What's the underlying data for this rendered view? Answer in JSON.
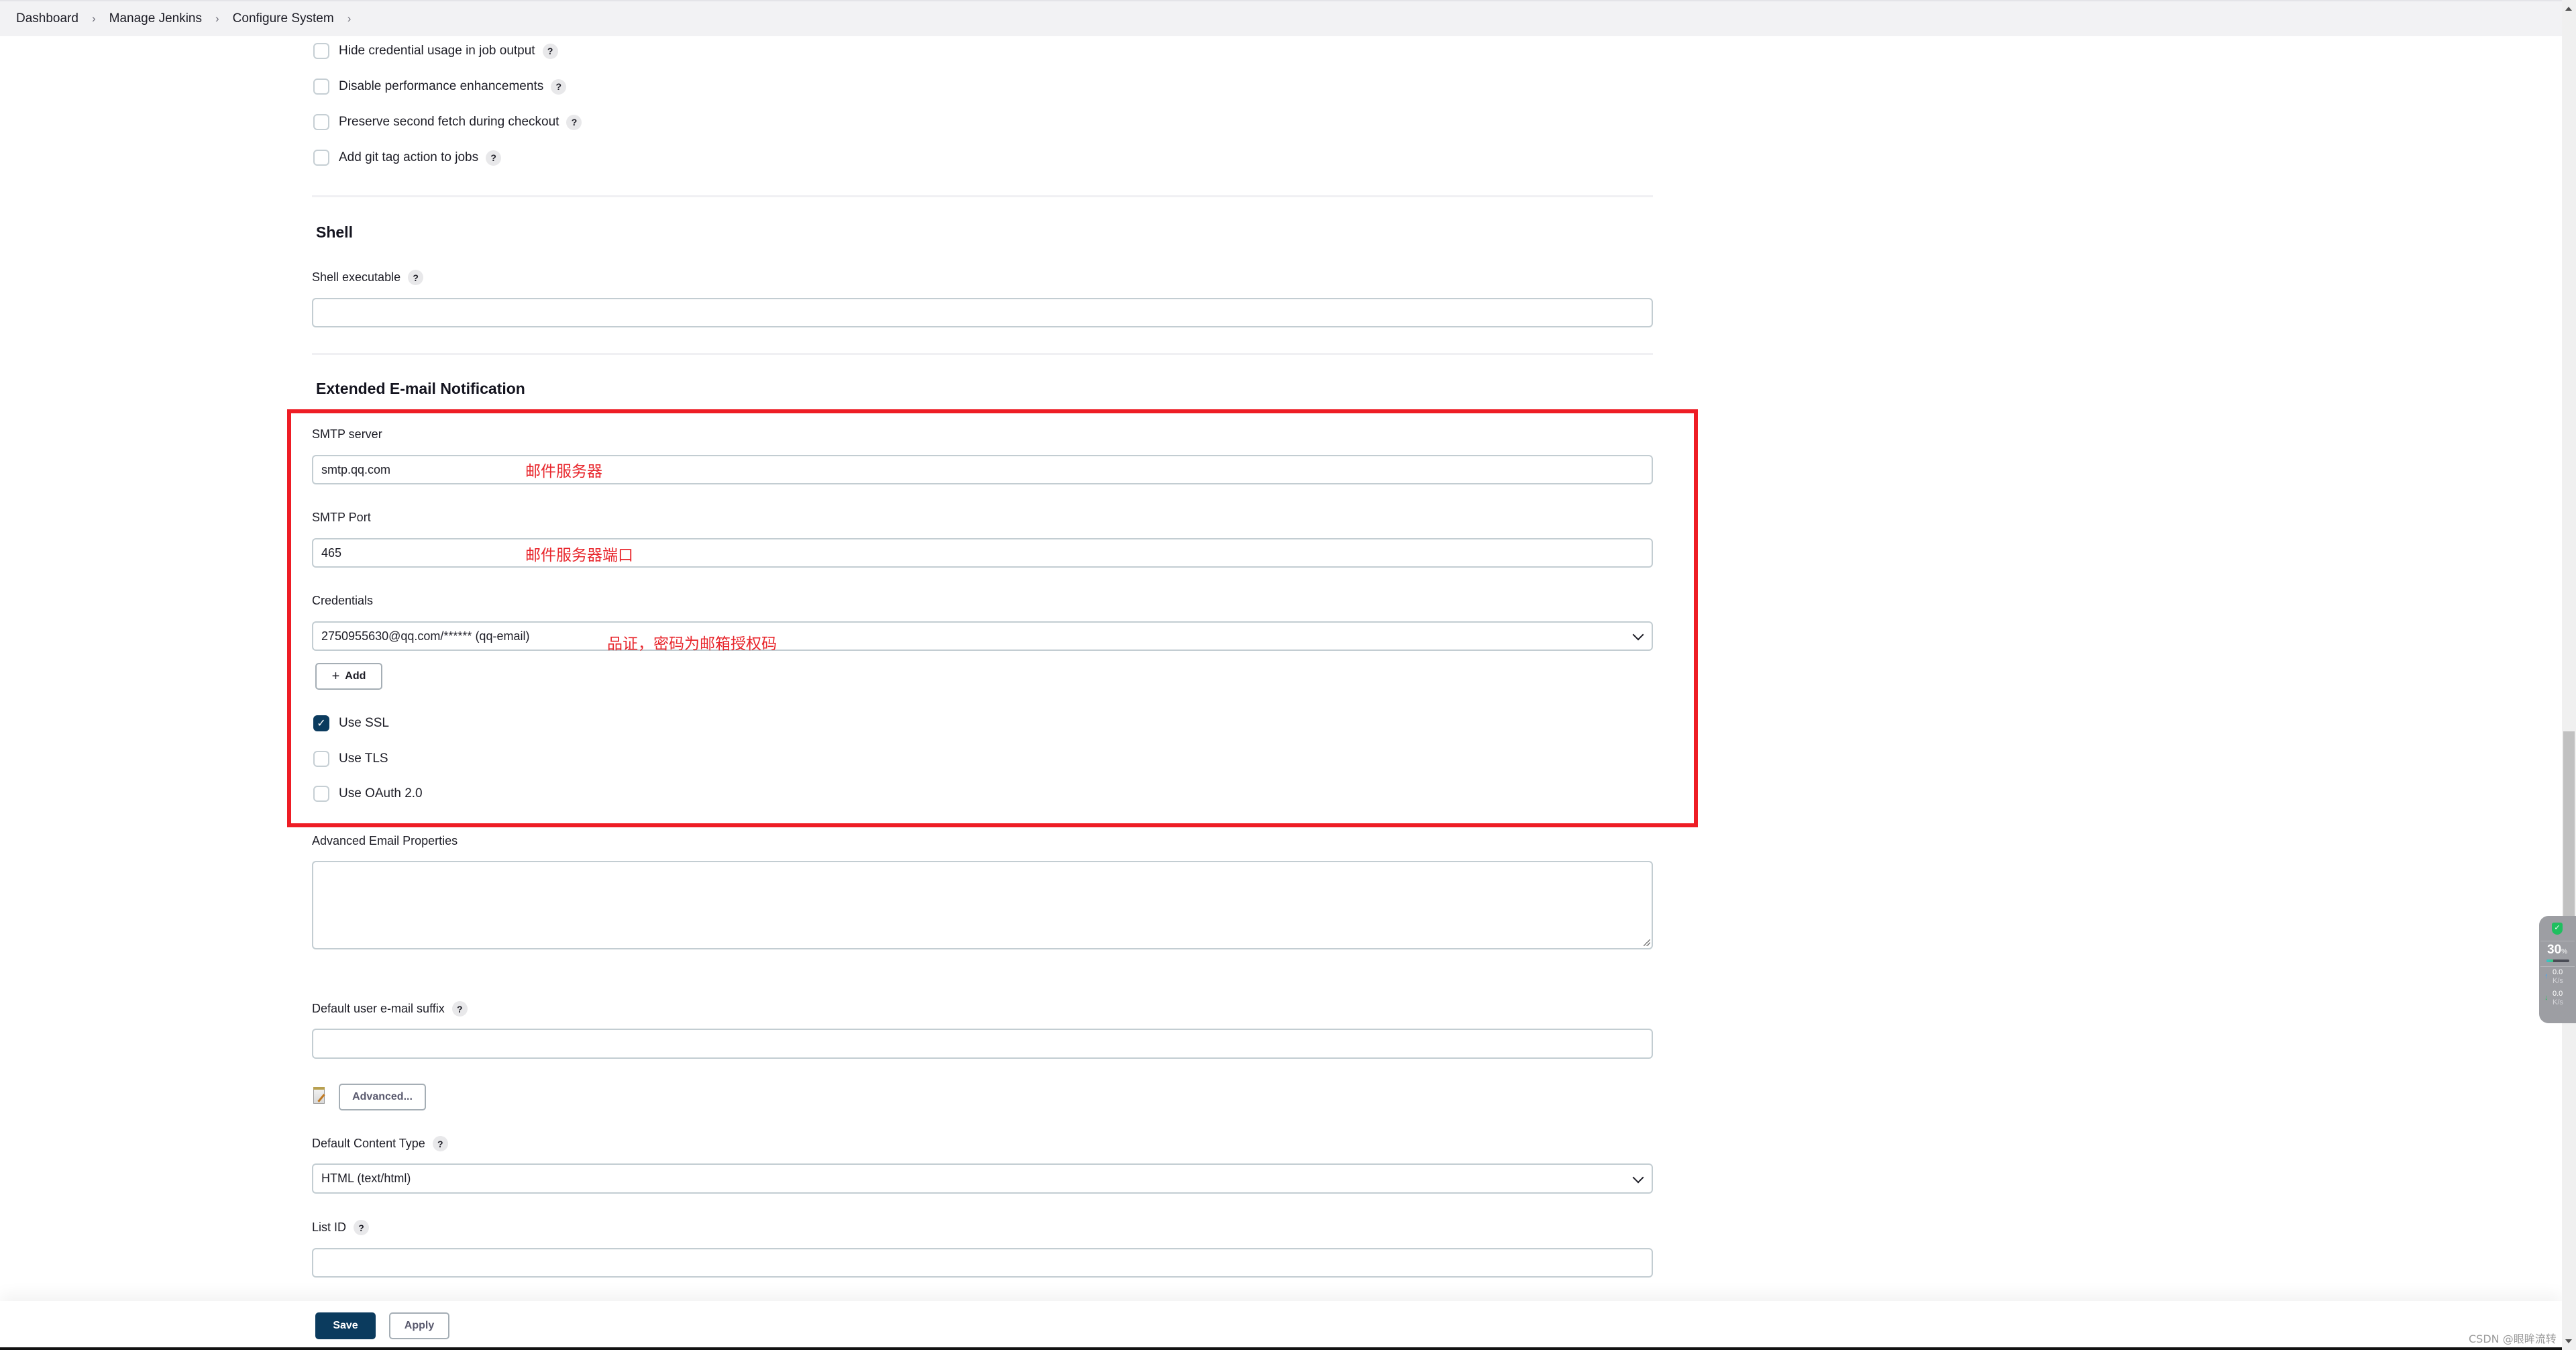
{
  "breadcrumb": [
    "Dashboard",
    "Manage Jenkins",
    "Configure System"
  ],
  "git_options": [
    {
      "label": "Hide credential usage in job output",
      "checked": false
    },
    {
      "label": "Disable performance enhancements",
      "checked": false
    },
    {
      "label": "Preserve second fetch during checkout",
      "checked": false
    },
    {
      "label": "Add git tag action to jobs",
      "checked": false
    }
  ],
  "help_glyph": "?",
  "shell": {
    "title": "Shell",
    "executable_label": "Shell executable",
    "executable_value": ""
  },
  "email_ext": {
    "title": "Extended E-mail Notification",
    "smtp_server_label": "SMTP server",
    "smtp_server_value": "smtp.qq.com",
    "smtp_server_annotation": "邮件服务器",
    "smtp_port_label": "SMTP Port",
    "smtp_port_value": "465",
    "smtp_port_annotation": "邮件服务器端口",
    "credentials_label": "Credentials",
    "credentials_value": "2750955630@qq.com/****** (qq-email)",
    "credentials_annotation": "品证，密码为邮箱授权码",
    "add_button": "Add",
    "add_icon": "+",
    "use_ssl": {
      "label": "Use SSL",
      "checked": true
    },
    "use_tls": {
      "label": "Use TLS",
      "checked": false
    },
    "use_oauth": {
      "label": "Use OAuth 2.0",
      "checked": false
    },
    "advanced_props_label": "Advanced Email Properties",
    "advanced_props_value": "",
    "default_suffix_label": "Default user e-mail suffix",
    "default_suffix_value": "",
    "advanced_button": "Advanced...",
    "content_type_label": "Default Content Type",
    "content_type_value": "HTML (text/html)",
    "list_id_label": "List ID",
    "list_id_value": ""
  },
  "footer": {
    "save": "Save",
    "apply": "Apply"
  },
  "widget": {
    "percent": "30",
    "percent_unit": "%",
    "upload": "0.0",
    "download": "0.0",
    "rate_unit": "K/s",
    "usage_fraction": 0.3
  },
  "watermark": "CSDN @眼眸流转",
  "colors": {
    "accent": "#0b3b5e",
    "annotation_red": "#ee1d25"
  }
}
